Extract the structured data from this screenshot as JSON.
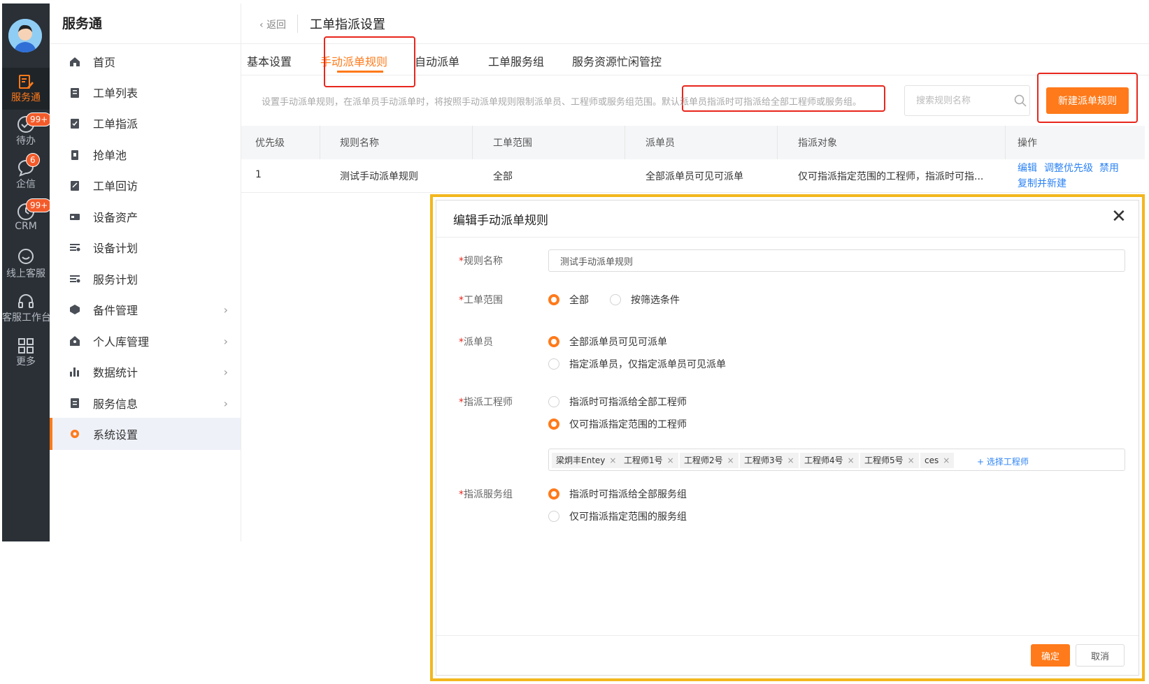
{
  "colors": {
    "accent": "#ff7a1a",
    "rail_bg": "#2a3036",
    "link": "#2d83f5",
    "highlight_box": "#e8261c",
    "modal_frame": "#f3b71d"
  },
  "rail": {
    "items": [
      {
        "label": "服务通",
        "icon": "ticket-edit-icon"
      },
      {
        "label": "待办",
        "icon": "check-circle-icon",
        "badge": "99+"
      },
      {
        "label": "企信",
        "icon": "chat-bubble-icon",
        "badge": "6"
      },
      {
        "label": "CRM",
        "icon": "clock-icon",
        "badge": "99+"
      },
      {
        "label": "线上客服",
        "icon": "smile-chat-icon"
      },
      {
        "label": "客服工作台",
        "icon": "headset-icon"
      },
      {
        "label": "更多",
        "icon": "grid-icon"
      }
    ]
  },
  "sidebar": {
    "title": "服务通",
    "items": [
      {
        "label": "首页",
        "icon": "home-icon"
      },
      {
        "label": "工单列表",
        "icon": "clipboard-icon"
      },
      {
        "label": "工单指派",
        "icon": "assign-icon"
      },
      {
        "label": "抢单池",
        "icon": "grab-icon"
      },
      {
        "label": "工单回访",
        "icon": "revisit-icon"
      },
      {
        "label": "设备资产",
        "icon": "device-icon"
      },
      {
        "label": "设备计划",
        "icon": "plan-icon"
      },
      {
        "label": "服务计划",
        "icon": "service-plan-icon"
      },
      {
        "label": "备件管理",
        "icon": "parts-icon"
      },
      {
        "label": "个人库管理",
        "icon": "personal-store-icon"
      },
      {
        "label": "数据统计",
        "icon": "bar-chart-icon"
      },
      {
        "label": "服务信息",
        "icon": "info-list-icon"
      },
      {
        "label": "系统设置",
        "icon": "gear-icon"
      }
    ]
  },
  "header": {
    "back_label": "返回",
    "title": "工单指派设置"
  },
  "tabs": [
    {
      "label": "基本设置"
    },
    {
      "label": "手动派单规则"
    },
    {
      "label": "自动派单"
    },
    {
      "label": "工单服务组"
    },
    {
      "label": "服务资源忙闲管控"
    }
  ],
  "toolbar": {
    "description": "设置手动派单规则，在派单员手动派单时，将按照手动派单规则限制派单员、工程师或服务组范围。",
    "description_highlight": "默认派单员指派时可指派给全部工程师或服务组。",
    "search_placeholder": "搜索规则名称",
    "new_button": "新建派单规则"
  },
  "table": {
    "headers": [
      "优先级",
      "规则名称",
      "工单范围",
      "派单员",
      "指派对象",
      "操作"
    ],
    "rows": [
      {
        "priority": "1",
        "name": "测试手动派单规则",
        "scope": "全部",
        "dispatcher": "全部派单员可见可派单",
        "target": "仅可指派指定范围的工程师，指派时可指...",
        "actions": {
          "edit": "编辑",
          "priority": "调整优先级",
          "disable": "禁用",
          "copy": "复制并新建"
        }
      }
    ]
  },
  "modal": {
    "title": "编辑手动派单规则",
    "fields": {
      "rule_name": {
        "label": "规则名称",
        "value": "测试手动派单规则"
      },
      "scope": {
        "label": "工单范围",
        "options": [
          "全部",
          "按筛选条件"
        ]
      },
      "dispatcher": {
        "label": "派单员",
        "options": [
          "全部派单员可见可派单",
          "指定派单员，仅指定派单员可见派单"
        ]
      },
      "engineer": {
        "label": "指派工程师",
        "options": [
          "指派时可指派给全部工程师",
          "仅可指派指定范围的工程师"
        ],
        "tags": [
          "梁炯丰Entey",
          "工程师1号",
          "工程师2号",
          "工程师3号",
          "工程师4号",
          "工程师5号",
          "ces"
        ],
        "add_label": "+ 选择工程师"
      },
      "group": {
        "label": "指派服务组",
        "options": [
          "指派时可指派给全部服务组",
          "仅可指派指定范围的服务组"
        ]
      }
    },
    "ok": "确定",
    "cancel": "取消"
  }
}
